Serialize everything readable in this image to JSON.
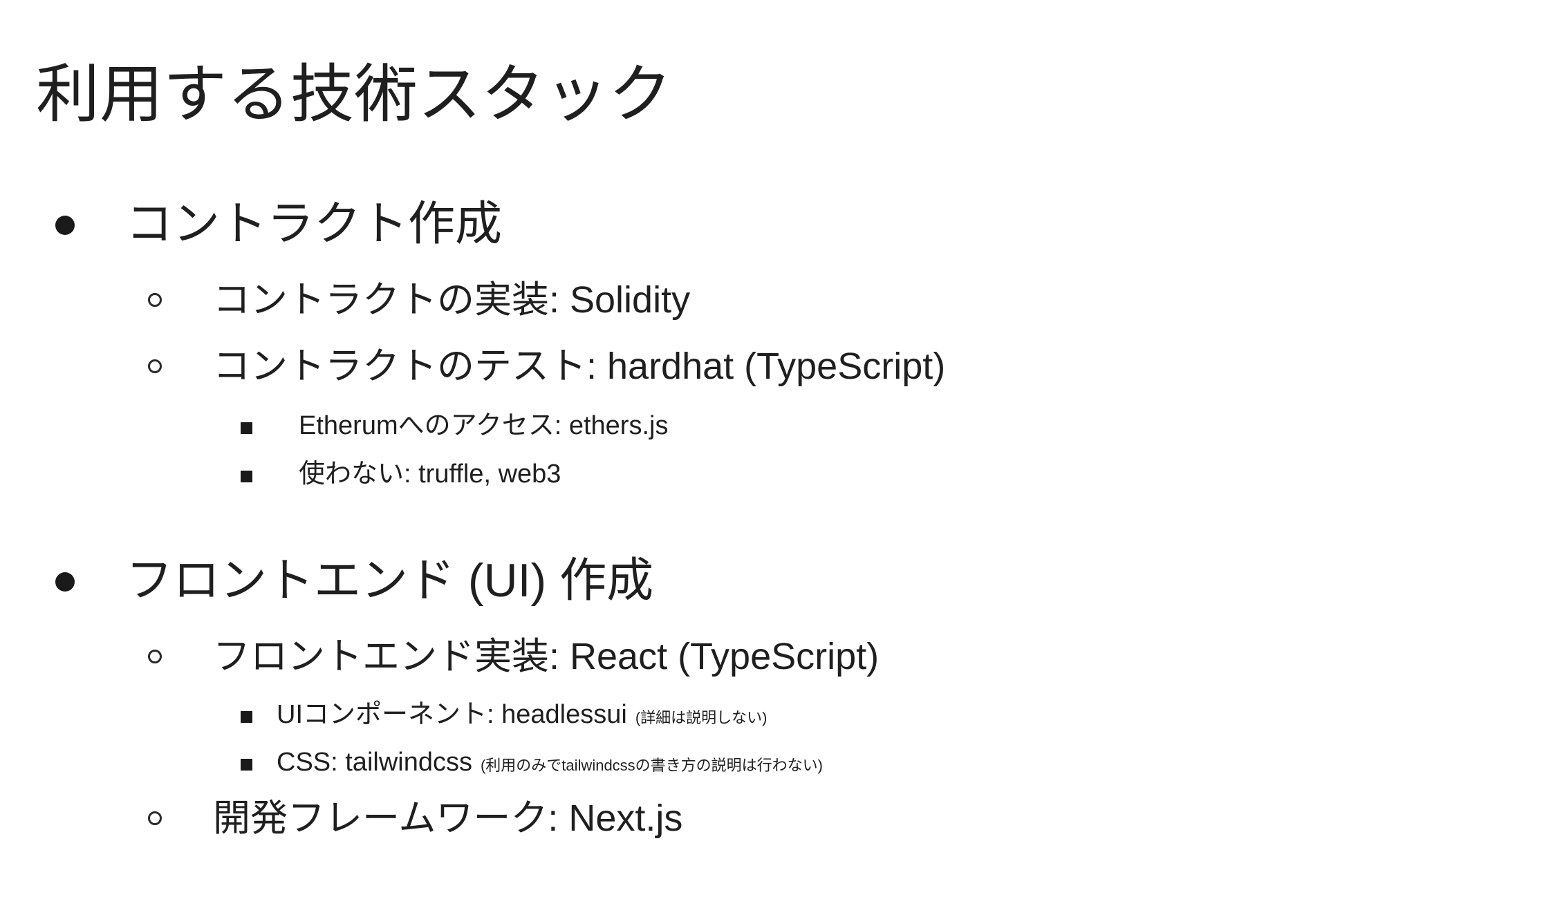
{
  "title": "利用する技術スタック",
  "sections": [
    {
      "label": "コントラクト作成",
      "items": [
        {
          "label": "コントラクトの実装: Solidity"
        },
        {
          "label": "コントラクトのテスト: hardhat (TypeScript)",
          "subitems": [
            {
              "label": "Etherumへのアクセス: ethers.js"
            },
            {
              "label": "使わない: truffle, web3"
            }
          ]
        }
      ]
    },
    {
      "label": "フロントエンド (UI) 作成",
      "items": [
        {
          "label": "フロントエンド実装: React (TypeScript)",
          "subitems": [
            {
              "label": "UIコンポーネント: headlessui",
              "note": "(詳細は説明しない)"
            },
            {
              "label": "CSS: tailwindcss",
              "note": "(利用のみでtailwindcssの書き方の説明は行わない)"
            }
          ]
        },
        {
          "label": "開発フレームワーク: Next.js"
        }
      ]
    }
  ]
}
